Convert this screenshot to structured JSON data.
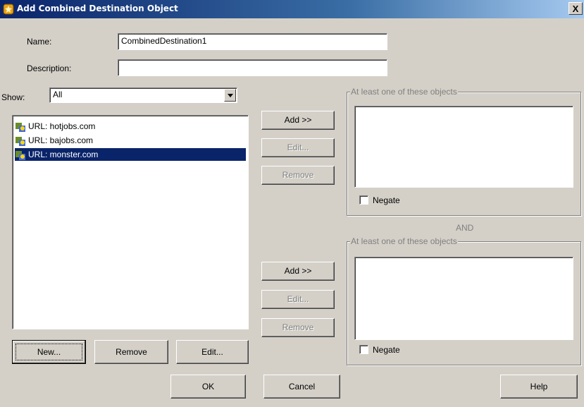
{
  "window": {
    "title": "Add Combined Destination Object",
    "close": "X"
  },
  "form": {
    "name_label": "Name:",
    "name_value": "CombinedDestination1",
    "description_label": "Description:",
    "description_value": "",
    "show_label": "Show:",
    "show_value": "All"
  },
  "list": {
    "items": [
      {
        "label": "URL: hotjobs.com",
        "icon": "url-object-icon",
        "selected": false
      },
      {
        "label": "URL: bajobs.com",
        "icon": "url-object-icon",
        "selected": false
      },
      {
        "label": "URL: monster.com",
        "icon": "url-object-icon",
        "selected": true
      }
    ]
  },
  "list_buttons": {
    "new": "New...",
    "remove": "Remove",
    "edit": "Edit..."
  },
  "group1": {
    "title": "At least one of these objects",
    "add": "Add >>",
    "edit": "Edit...",
    "remove": "Remove",
    "negate": "Negate"
  },
  "and_label": "AND",
  "group2": {
    "title": "At least one of these objects",
    "add": "Add >>",
    "edit": "Edit...",
    "remove": "Remove",
    "negate": "Negate"
  },
  "footer": {
    "ok": "OK",
    "cancel": "Cancel",
    "help": "Help"
  },
  "colors": {
    "title_bar": "#0a246a",
    "selection": "#0a246a",
    "dialog_bg": "#d4d0c8"
  }
}
